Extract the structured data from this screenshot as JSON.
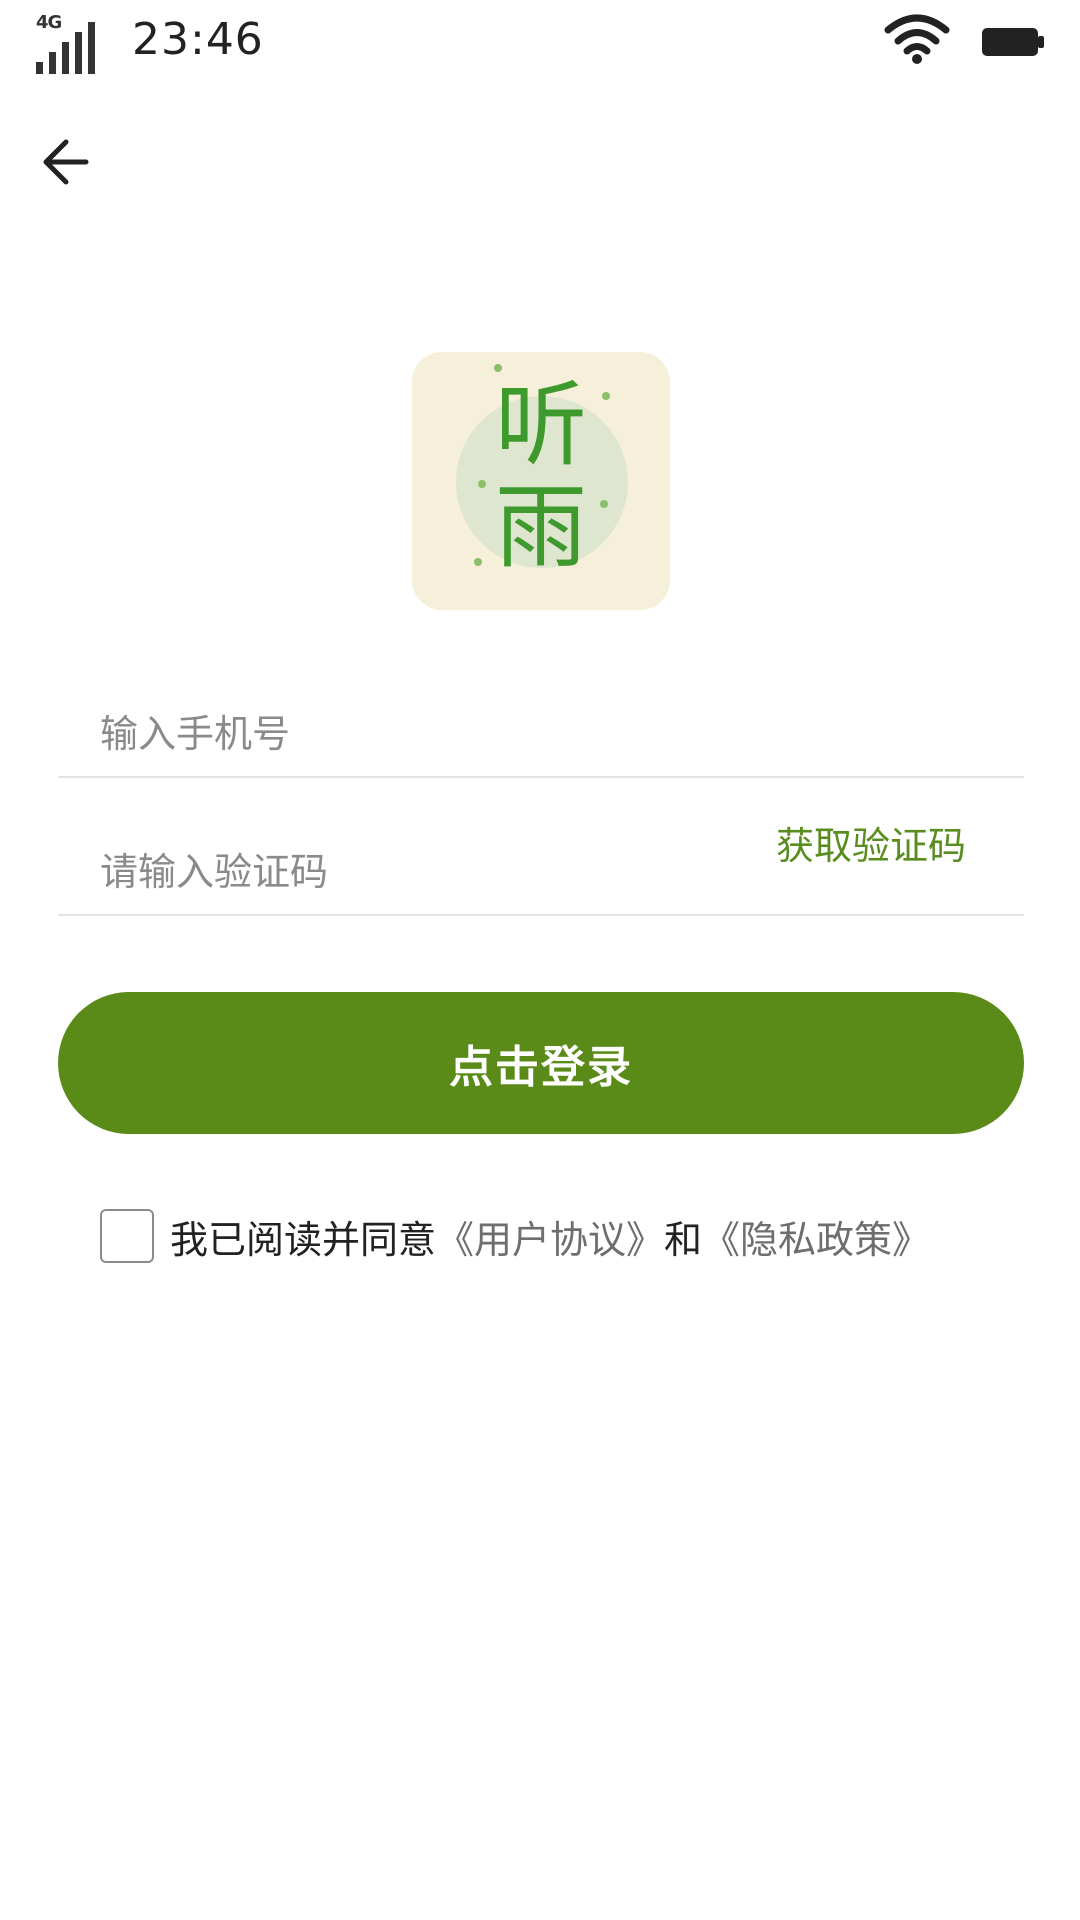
{
  "status_bar": {
    "network": "4G",
    "time": "23:46"
  },
  "icons": {
    "back": "arrow-left-icon",
    "signal": "signal-icon",
    "wifi": "wifi-icon",
    "battery": "battery-icon"
  },
  "logo": {
    "char_top": "听",
    "char_bottom": "雨"
  },
  "form": {
    "phone_placeholder": "输入手机号",
    "code_placeholder": "请输入验证码",
    "get_code_label": "获取验证码",
    "login_label": "点击登录"
  },
  "agreement": {
    "prefix": "我已阅读并同意",
    "user_agreement": "《用户协议》",
    "conjunction": "和",
    "privacy_policy": "《隐私政策》",
    "checked": false
  },
  "colors": {
    "primary": "#5a8b18",
    "link_green": "#5a8d1f",
    "logo_bg": "#f6efd9",
    "logo_text": "#3f9a2e"
  }
}
